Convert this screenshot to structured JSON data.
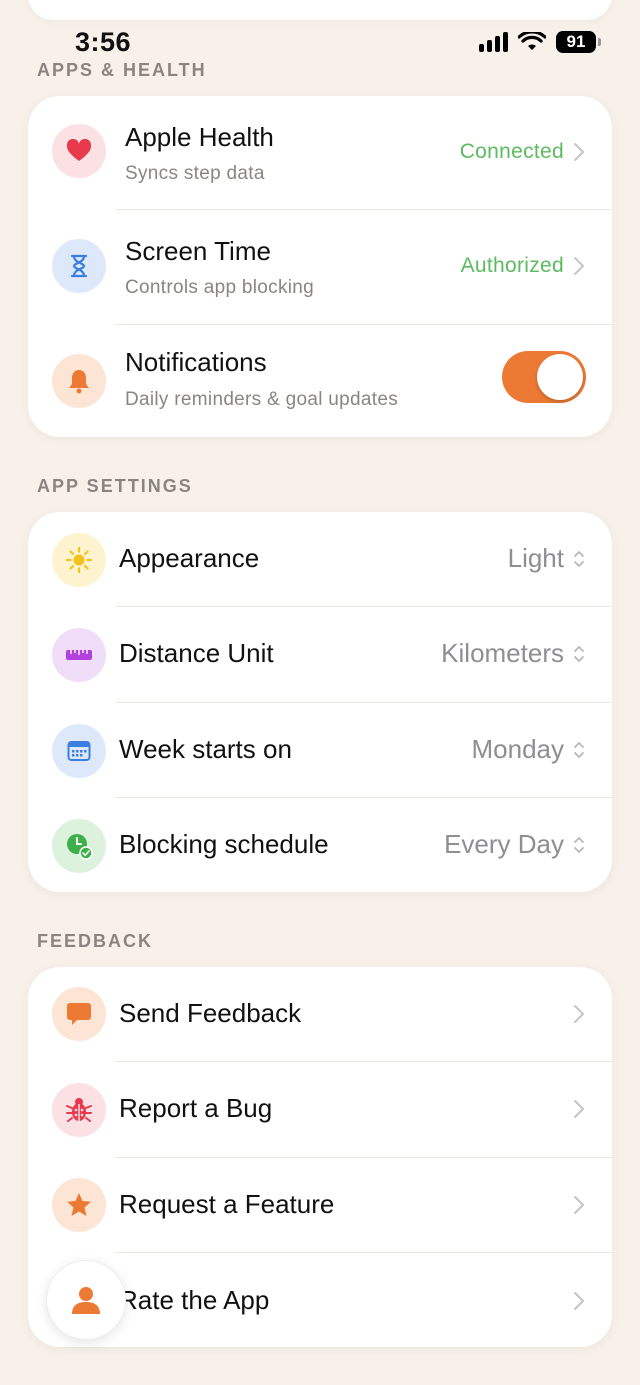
{
  "status_bar": {
    "time": "3:56",
    "battery": "91"
  },
  "sections": {
    "apps_health": {
      "header": "APPS & HEALTH",
      "rows": [
        {
          "title": "Apple Health",
          "subtitle": "Syncs step data",
          "status": "Connected"
        },
        {
          "title": "Screen Time",
          "subtitle": "Controls app blocking",
          "status": "Authorized"
        },
        {
          "title": "Notifications",
          "subtitle": "Daily reminders & goal updates",
          "toggle_on": true
        }
      ]
    },
    "app_settings": {
      "header": "APP SETTINGS",
      "rows": [
        {
          "title": "Appearance",
          "value": "Light"
        },
        {
          "title": "Distance Unit",
          "value": "Kilometers"
        },
        {
          "title": "Week starts on",
          "value": "Monday"
        },
        {
          "title": "Blocking schedule",
          "value": "Every Day"
        }
      ]
    },
    "feedback": {
      "header": "FEEDBACK",
      "rows": [
        {
          "title": "Send Feedback"
        },
        {
          "title": "Report a Bug"
        },
        {
          "title": "Request a Feature"
        },
        {
          "title": "Rate the App"
        }
      ]
    }
  },
  "colors": {
    "background": "#f7f1e9",
    "accent_orange": "#ec7a34",
    "status_green": "#5cba5f",
    "secondary_text": "#8a8580"
  },
  "icons": {
    "apple_health": "heart-icon",
    "screen_time": "hourglass-icon",
    "notifications": "bell-icon",
    "appearance": "sun-icon",
    "distance_unit": "ruler-icon",
    "week_starts_on": "calendar-icon",
    "blocking_schedule": "clock-check-icon",
    "send_feedback": "speech-bubble-icon",
    "report_bug": "bug-icon",
    "request_feature": "star-icon",
    "profile": "person-icon"
  }
}
